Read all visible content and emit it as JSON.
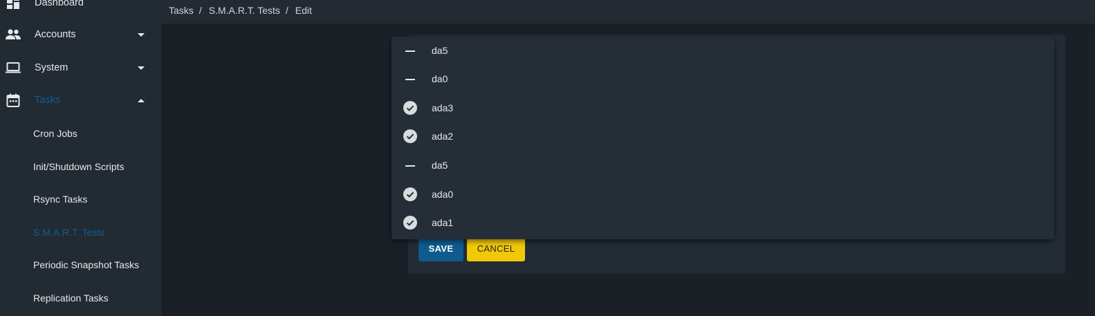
{
  "sidebar": {
    "items": [
      {
        "label": "Dashboard",
        "icon": "dashboard-icon"
      },
      {
        "label": "Accounts",
        "icon": "people-icon"
      },
      {
        "label": "System",
        "icon": "laptop-icon"
      },
      {
        "label": "Tasks",
        "icon": "calendar-icon"
      }
    ],
    "subitems": [
      {
        "label": "Cron Jobs"
      },
      {
        "label": "Init/Shutdown Scripts"
      },
      {
        "label": "Rsync Tasks"
      },
      {
        "label": "S.M.A.R.T. Tests"
      },
      {
        "label": "Periodic Snapshot Tasks"
      },
      {
        "label": "Replication Tasks"
      }
    ],
    "active_color": "#0e5f96"
  },
  "breadcrumb": {
    "items": [
      "Tasks",
      "S.M.A.R.T. Tests",
      "Edit"
    ],
    "separator": "/"
  },
  "form": {
    "save_label": "SAVE",
    "cancel_label": "CANCEL"
  },
  "disk_options": [
    {
      "label": "da5",
      "state": "indeterminate"
    },
    {
      "label": "da0",
      "state": "indeterminate"
    },
    {
      "label": "ada3",
      "state": "checked"
    },
    {
      "label": "ada2",
      "state": "checked"
    },
    {
      "label": "da5",
      "state": "indeterminate"
    },
    {
      "label": "ada0",
      "state": "checked"
    },
    {
      "label": "ada1",
      "state": "checked"
    }
  ],
  "colors": {
    "primary": "#0e5b8f",
    "accent": "#f0c808",
    "background": "#1b2027",
    "sidebar": "#222a32"
  }
}
